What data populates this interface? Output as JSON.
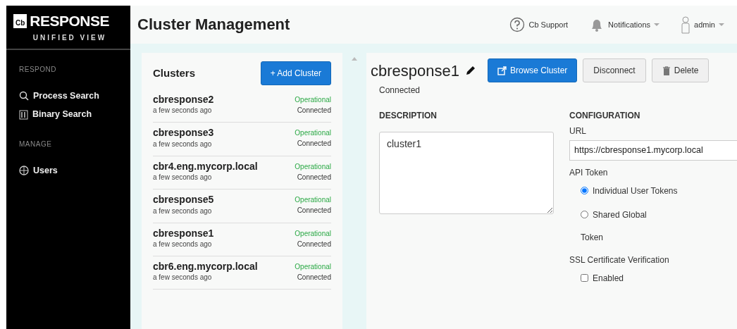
{
  "logo": {
    "badge": "Cb",
    "name": "RESPONSE",
    "subtitle": "UNIFIED VIEW"
  },
  "sidebar": {
    "sections": [
      {
        "heading": "RESPOND",
        "items": [
          {
            "label": "Process Search",
            "kind": "search"
          },
          {
            "label": "Binary Search",
            "kind": "binary"
          }
        ]
      },
      {
        "heading": "MANAGE",
        "items": [
          {
            "label": "Users",
            "kind": "users"
          }
        ]
      }
    ]
  },
  "page_title": "Cluster Management",
  "header_links": [
    {
      "label": "Cb Support",
      "kind": "help",
      "dropdown": false
    },
    {
      "label": "Notifications",
      "kind": "bell",
      "dropdown": true
    },
    {
      "label": "admin",
      "kind": "user",
      "dropdown": true
    }
  ],
  "clusters_panel": {
    "title": "Clusters",
    "add_button": "+ Add Cluster",
    "items": [
      {
        "name": "cbresponse2",
        "time": "a few seconds ago",
        "health": "Operational",
        "status": "Connected"
      },
      {
        "name": "cbresponse3",
        "time": "a few seconds ago",
        "health": "Operational",
        "status": "Connected"
      },
      {
        "name": "cbr4.eng.mycorp.local",
        "time": "a few seconds ago",
        "health": "Operational",
        "status": "Connected"
      },
      {
        "name": "cbresponse5",
        "time": "a few seconds ago",
        "health": "Operational",
        "status": "Connected"
      },
      {
        "name": "cbresponse1",
        "time": "a few seconds ago",
        "health": "Operational",
        "status": "Connected"
      },
      {
        "name": "cbr6.eng.mycorp.local",
        "time": "a few seconds ago",
        "health": "Operational",
        "status": "Connected"
      }
    ]
  },
  "detail": {
    "name": "cbresponse1",
    "status": "Connected",
    "buttons": [
      {
        "label": "Browse Cluster",
        "kind": "browse"
      },
      {
        "label": "Disconnect",
        "kind": "plain"
      },
      {
        "label": "Delete",
        "kind": "delete"
      }
    ],
    "description": {
      "heading": "DESCRIPTION",
      "value": "cluster1"
    },
    "configuration": {
      "heading": "CONFIGURATION",
      "url_label": "URL",
      "url": "https://cbresponse1.mycorp.local",
      "api_token_label": "API Token",
      "token_options": [
        {
          "label": "Individual User Tokens",
          "selected": true
        },
        {
          "label": "Shared Global",
          "selected": false
        }
      ],
      "token_label": "Token",
      "ssl_label": "SSL Certificate Verification",
      "ssl_option": {
        "label": "Enabled",
        "checked": false
      }
    }
  }
}
